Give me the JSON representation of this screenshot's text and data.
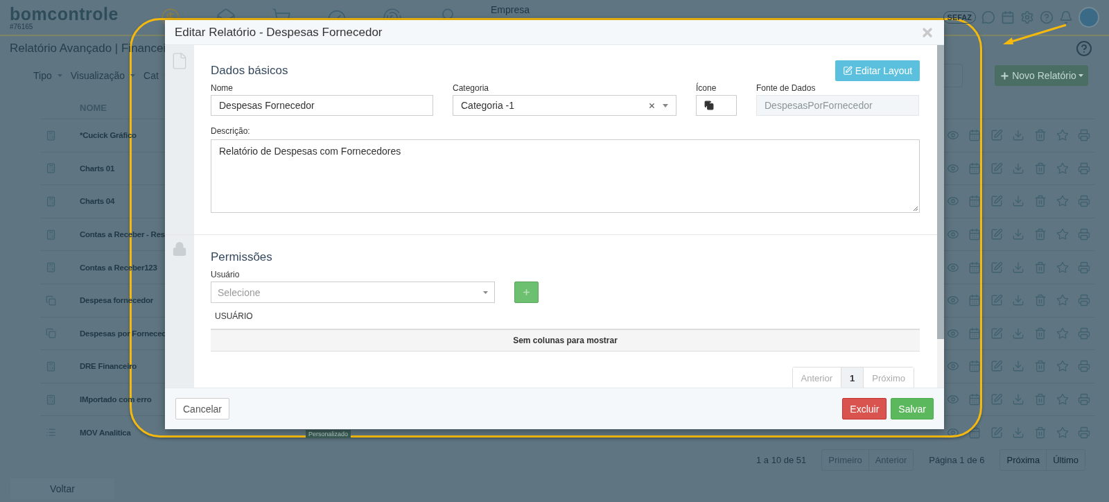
{
  "header": {
    "logo": "bomcontrole",
    "account_id": "#76165",
    "company_menu": "Empresa",
    "sefaz_badge": "SEFAZ"
  },
  "page": {
    "title": "Relatório Avançado | Financei",
    "filters": [
      "Tipo",
      "Visualização",
      "Cat"
    ],
    "new_button": "Novo Relatório"
  },
  "table": {
    "columns": [
      "NOME"
    ],
    "rows": [
      {
        "name": "*Cucick Gráfico",
        "kind": "grid"
      },
      {
        "name": "Charts 01",
        "kind": "grid"
      },
      {
        "name": "Charts 04",
        "kind": "grid"
      },
      {
        "name": "Contas a Receber - Res",
        "kind": "grid"
      },
      {
        "name": "Contas a Receber123",
        "kind": "grid"
      },
      {
        "name": "Despesa fornecedor",
        "kind": "files"
      },
      {
        "name": "Despesas por Fornecec",
        "kind": "files"
      },
      {
        "name": "DRE Financeiro",
        "kind": "grid"
      },
      {
        "name": "IMportado com erro",
        "kind": "grid"
      },
      {
        "name": "MOV Analitica",
        "kind": "list",
        "tag": "Personalizado"
      }
    ]
  },
  "pagination": {
    "summary": "1 a 10 de 51",
    "before": [
      {
        "label": "Primeiro",
        "disabled": true
      },
      {
        "label": "Anterior",
        "disabled": true
      }
    ],
    "page_info": "Página 1 de 6",
    "after": [
      {
        "label": "Próxima",
        "disabled": false
      },
      {
        "label": "Último",
        "disabled": false
      }
    ]
  },
  "back_button": "Voltar",
  "modal": {
    "title": "Editar Relatório - Despesas Fornecedor",
    "basic": {
      "heading": "Dados básicos",
      "edit_layout_button": "Editar Layout",
      "fields": [
        {
          "label": "Nome",
          "value": "Despesas Fornecedor",
          "kind": "text",
          "disabled": false
        },
        {
          "label": "Categoria",
          "value": "Categoria -1",
          "kind": "select",
          "disabled": false
        },
        {
          "label": "Ícone",
          "kind": "icon",
          "disabled": false
        },
        {
          "label": "Fonte de Dados",
          "value": "DespesasPorFornecedor",
          "kind": "text",
          "disabled": true
        }
      ],
      "description_label": "Descrição:",
      "description": "Relatório de Despesas com Fornecedores"
    },
    "permissions": {
      "heading": "Permissões",
      "user_label": "Usuário",
      "user_placeholder": "Selecione",
      "columns": [
        "USUÁRIO"
      ],
      "empty_text": "Sem colunas para mostrar",
      "pagination": [
        {
          "label": "Anterior",
          "selected": false
        },
        {
          "label": "1",
          "selected": true
        },
        {
          "label": "Próximo",
          "selected": false
        }
      ]
    },
    "buttons": [
      {
        "label": "Cancelar",
        "kind": "default"
      },
      {
        "label": "Excluir",
        "kind": "danger"
      },
      {
        "label": "Salvar",
        "kind": "success"
      }
    ]
  }
}
